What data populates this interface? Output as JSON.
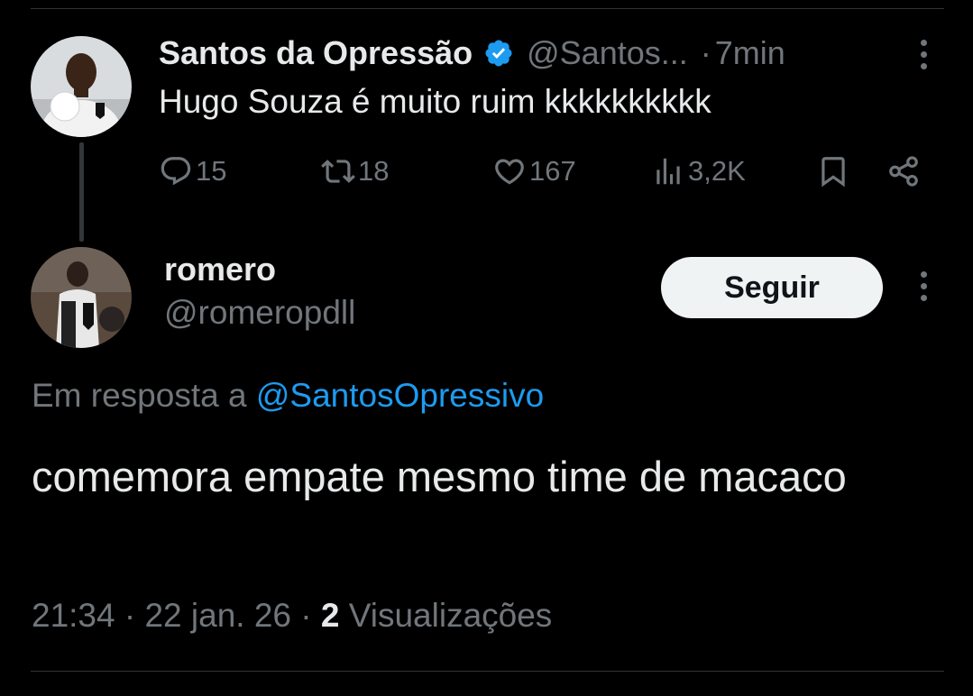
{
  "parent_tweet": {
    "author_name": "Santos da Opressão",
    "author_handle": "@Santos...",
    "separator": "·",
    "time": "7min",
    "text": "Hugo Souza é muito ruim kkkkkkkkkk",
    "stats": {
      "replies": "15",
      "retweets": "18",
      "likes": "167",
      "views": "3,2K"
    }
  },
  "reply_tweet": {
    "author_name": "romero",
    "author_handle": "@romeropdll",
    "follow_label": "Seguir",
    "reply_prefix": "Em resposta a",
    "reply_mention": "@SantosOpressivo",
    "text": "comemora empate mesmo time de macaco",
    "timestamp": "21:34 · 22 jan. 26 ·",
    "views_count": "2",
    "views_label": "Visualizações"
  },
  "colors": {
    "background": "#000000",
    "primary_text": "#e7e9ea",
    "secondary_text": "#71767b",
    "accent_blue": "#1d9bf0",
    "follow_button_bg": "#eff3f4"
  },
  "icons": {
    "verified": "verified-badge-icon",
    "reply": "comment-bubble-icon",
    "retweet": "retweet-icon",
    "like": "heart-icon",
    "views": "bar-chart-icon",
    "bookmark": "bookmark-icon",
    "share": "share-icon",
    "more": "vertical-ellipsis-icon"
  }
}
